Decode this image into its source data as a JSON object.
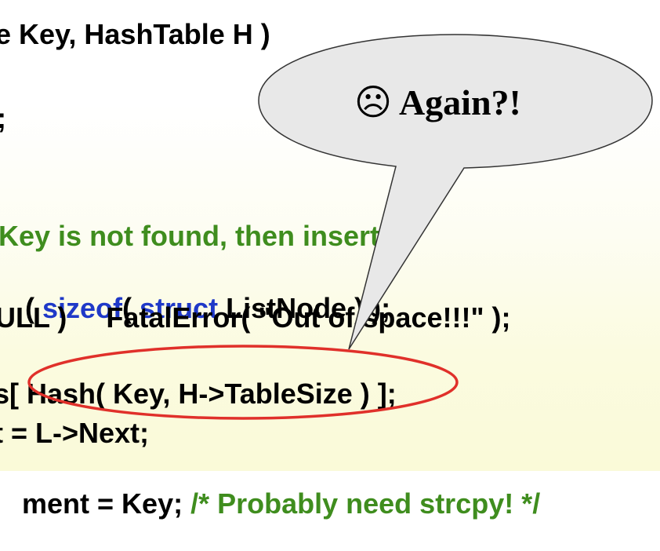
{
  "code": {
    "line1": {
      "text": "e Key, HashTable H )"
    },
    "line2": {
      "text": ";"
    },
    "line3": {
      "comment": "Key is not found, then insert */"
    },
    "line4": {
      "open": "( ",
      "kw1": "sizeof",
      "mid": "( ",
      "kw2": "struct",
      "rest": " ListNode ) );"
    },
    "line5": {
      "text": "ULL )     FatalError( \"Out of space!!!\" );"
    },
    "line6": {
      "text": "s[ Hash( Key, H->TableSize ) ];"
    },
    "line7": {
      "text": "t = L->Next;"
    },
    "line8": {
      "text": "ment = Key; ",
      "comment": "/* Probably need strcpy! */"
    }
  },
  "bubble": {
    "face": "☹",
    "text": "Again?!"
  },
  "colors": {
    "keyword": "#1f39c8",
    "comment": "#3f8d1e",
    "highlight": "#e0302a"
  }
}
